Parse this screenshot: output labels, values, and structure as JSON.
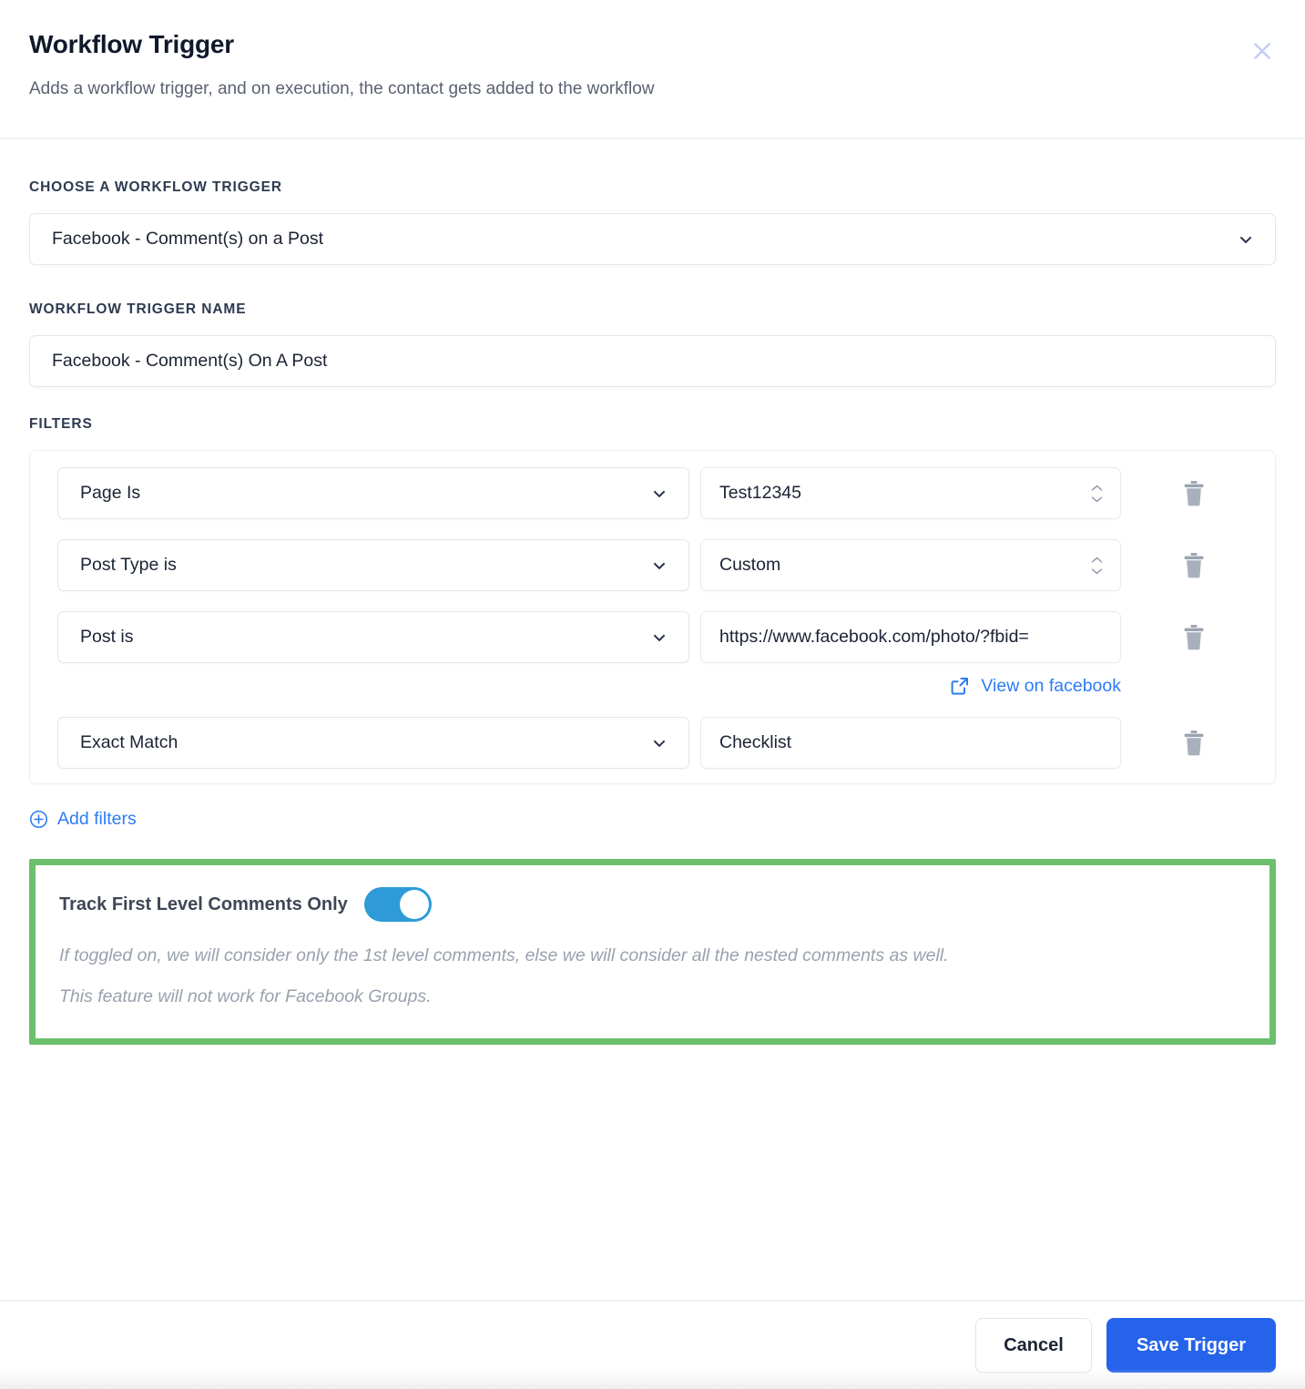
{
  "header": {
    "title": "Workflow Trigger",
    "subtitle": "Adds a workflow trigger, and on execution, the contact gets added to the workflow",
    "close_icon": "close-icon"
  },
  "form": {
    "trigger_select_label": "CHOOSE A WORKFLOW TRIGGER",
    "trigger_select_value": "Facebook - Comment(s) on a Post",
    "trigger_name_label": "WORKFLOW TRIGGER NAME",
    "trigger_name_value": "Facebook - Comment(s) On A Post",
    "filters_label": "FILTERS"
  },
  "filters": {
    "rows": [
      {
        "key": "Page Is",
        "value": "Test12345",
        "has_stepper": true,
        "link": null
      },
      {
        "key": "Post Type is",
        "value": "Custom",
        "has_stepper": true,
        "link": null
      },
      {
        "key": "Post is",
        "value": "https://www.facebook.com/photo/?fbid=",
        "has_stepper": false,
        "link": "View on facebook"
      },
      {
        "key": "Exact Match",
        "value": "Checklist",
        "has_stepper": false,
        "link": null
      }
    ],
    "add_filters_label": "Add filters",
    "delete_icon": "trash-icon",
    "add_icon": "plus-circle-icon",
    "external_link_icon": "external-link-icon"
  },
  "highlight": {
    "toggle_label": "Track First Level Comments Only",
    "toggle_on": true,
    "hint_line_1": "If toggled on, we will consider only the 1st level comments, else we will consider all the nested comments as well.",
    "hint_line_2": "This feature will not work for Facebook Groups.",
    "border_color": "#6cbf6c"
  },
  "footer": {
    "cancel_label": "Cancel",
    "save_label": "Save Trigger",
    "primary_color": "#2563eb"
  }
}
